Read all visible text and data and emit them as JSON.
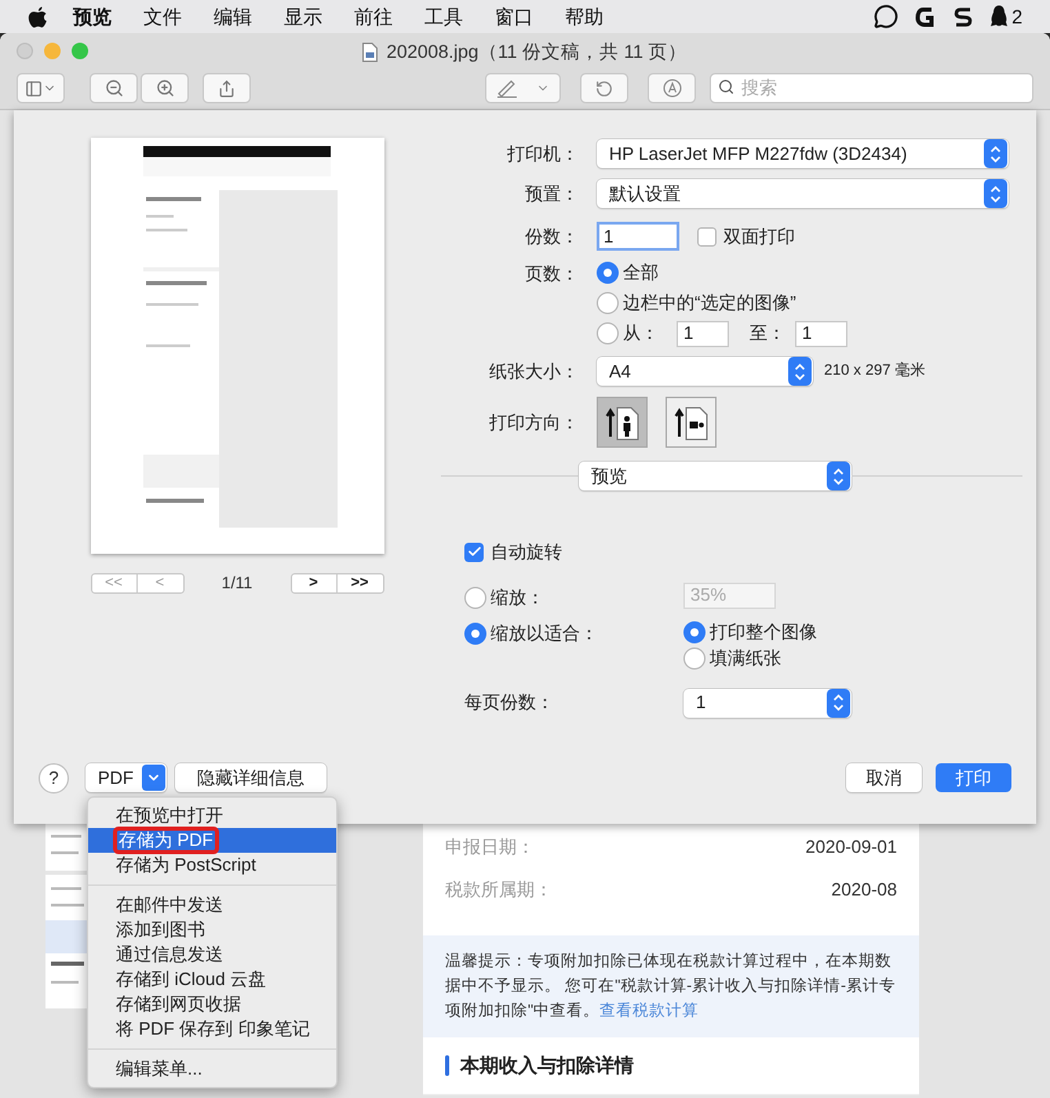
{
  "menubar": {
    "items": [
      "预览",
      "文件",
      "编辑",
      "显示",
      "前往",
      "工具",
      "窗口",
      "帮助"
    ],
    "badge": "2"
  },
  "window": {
    "title": "202008.jpg（11 份文稿，共 11 页）"
  },
  "toolbar": {
    "search": {
      "placeholder": "搜索"
    }
  },
  "print_dialog": {
    "preview": {
      "page_indicator": "1/11",
      "nav_buttons": [
        "<<",
        "<",
        ">",
        ">>"
      ]
    },
    "printer": {
      "label": "打印机：",
      "value": "HP LaserJet MFP M227fdw (3D2434)"
    },
    "preset": {
      "label": "预置：",
      "value": "默认设置"
    },
    "copies": {
      "label": "份数：",
      "value": "1",
      "duplex": {
        "label": "双面打印",
        "checked": false
      }
    },
    "pages": {
      "label": "页数：",
      "options": [
        {
          "label": "全部",
          "selected": true
        },
        {
          "label": "边栏中的“选定的图像”",
          "selected": false
        },
        {
          "label": "从：",
          "selected": false
        }
      ],
      "from": "1",
      "to_label": "至：",
      "to": "1"
    },
    "paper_size": {
      "label": "纸张大小：",
      "value": "A4",
      "dimensions": "210 x 297 毫米"
    },
    "orientation": {
      "label": "打印方向：",
      "options": [
        {
          "kind": "portrait",
          "selected": true
        },
        {
          "kind": "landscape",
          "selected": false
        }
      ]
    },
    "section": {
      "value": "预览"
    },
    "auto_rotate": {
      "label": "自动旋转",
      "checked": true
    },
    "scale": {
      "options": [
        {
          "label": "缩放：",
          "selected": false
        },
        {
          "label": "缩放以适合：",
          "selected": true
        }
      ],
      "percent": "35%"
    },
    "fit": {
      "options": [
        {
          "label": "打印整个图像",
          "selected": true
        },
        {
          "label": "填满纸张",
          "selected": false
        }
      ]
    },
    "pages_per_sheet": {
      "label": "每页份数：",
      "value": "1"
    },
    "footer": {
      "help": "?",
      "pdf": "PDF",
      "details": "隐藏详细信息",
      "cancel": "取消",
      "print": "打印"
    }
  },
  "pdf_menu": {
    "groups": [
      [
        {
          "label": "在预览中打开",
          "selected": false,
          "marked": false
        },
        {
          "label": "存储为 PDF",
          "selected": true,
          "marked": true
        },
        {
          "label": "存储为 PostScript",
          "selected": false,
          "marked": false
        }
      ],
      [
        {
          "label": "在邮件中发送",
          "selected": false,
          "marked": false
        },
        {
          "label": "添加到图书",
          "selected": false,
          "marked": false
        },
        {
          "label": "通过信息发送",
          "selected": false,
          "marked": false
        },
        {
          "label": "存储到 iCloud 云盘",
          "selected": false,
          "marked": false
        },
        {
          "label": "存储到网页收据",
          "selected": false,
          "marked": false
        },
        {
          "label": "将 PDF 保存到 印象笔记",
          "selected": false,
          "marked": false
        }
      ],
      [
        {
          "label": "编辑菜单...",
          "selected": false,
          "marked": false
        }
      ]
    ]
  },
  "document": {
    "rows": [
      {
        "label": "申报日期：",
        "value": "2020-09-01"
      },
      {
        "label": "税款所属期：",
        "value": "2020-08"
      }
    ],
    "notice": "温馨提示：专项附加扣除已体现在税款计算过程中，在本期数据中不予显示。 您可在\"税款计算-累计收入与扣除详情-累计专项附加扣除\"中查看。",
    "notice_link": "查看税款计算",
    "section_title": "本期收入与扣除详情"
  }
}
